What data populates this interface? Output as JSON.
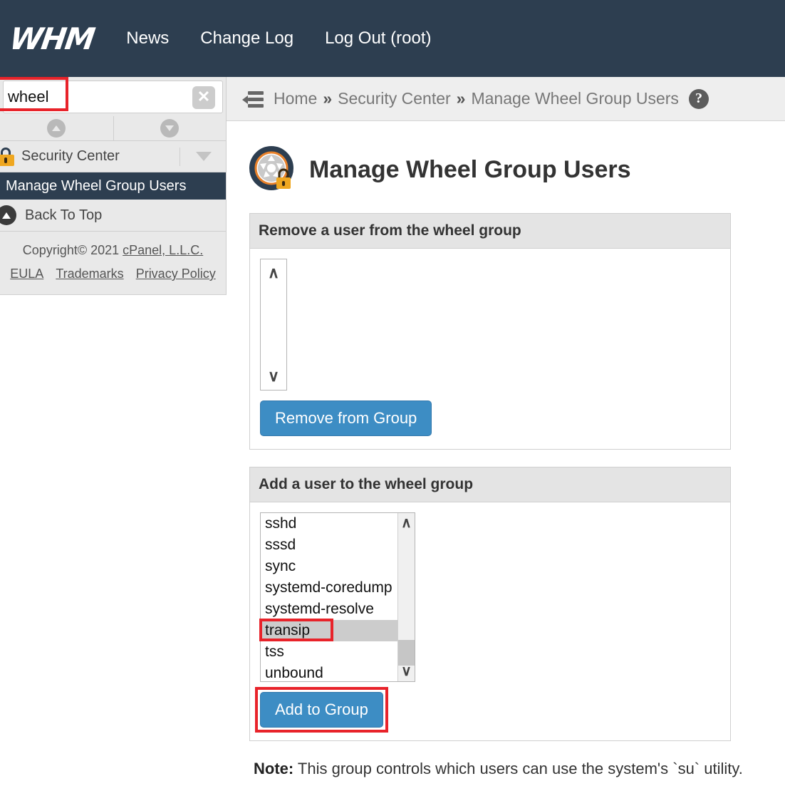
{
  "header": {
    "logo_text": "WHM",
    "nav": [
      {
        "label": "News"
      },
      {
        "label": "Change Log"
      },
      {
        "label": "Log Out (root)"
      }
    ]
  },
  "sidebar": {
    "search": {
      "value": "wheel",
      "placeholder": ""
    },
    "scroll_up_label": "scroll-up",
    "scroll_down_label": "scroll-down",
    "group": {
      "label": "Security Center"
    },
    "active_item": {
      "label": "Manage Wheel Group Users"
    },
    "back_to_top": {
      "label": "Back To Top"
    },
    "footer": {
      "copyright_prefix": "Copyright© 2021 ",
      "company_link": "cPanel, L.L.C.",
      "links": [
        {
          "label": "EULA"
        },
        {
          "label": "Trademarks"
        },
        {
          "label": "Privacy Policy"
        }
      ]
    }
  },
  "breadcrumb": {
    "items": [
      {
        "label": "Home"
      },
      {
        "label": "Security Center"
      },
      {
        "label": "Manage Wheel Group Users"
      }
    ],
    "separator": "»",
    "help_glyph": "?"
  },
  "page": {
    "title": "Manage Wheel Group Users",
    "icon": "wheel-lock-icon"
  },
  "remove_panel": {
    "heading": "Remove a user from the wheel group",
    "users": [],
    "button_label": "Remove from Group",
    "scroll_up_glyph": "∧",
    "scroll_down_glyph": "∨"
  },
  "add_panel": {
    "heading": "Add a user to the wheel group",
    "users": [
      {
        "label": "sshd",
        "selected": false
      },
      {
        "label": "sssd",
        "selected": false
      },
      {
        "label": "sync",
        "selected": false
      },
      {
        "label": "systemd-coredump",
        "selected": false
      },
      {
        "label": "systemd-resolve",
        "selected": false
      },
      {
        "label": "transip",
        "selected": true
      },
      {
        "label": "tss",
        "selected": false
      },
      {
        "label": "unbound",
        "selected": false
      }
    ],
    "selected_user": "transip",
    "button_label": "Add to Group",
    "scroll_up_glyph": "∧",
    "scroll_down_glyph": "∨"
  },
  "note": {
    "label": "Note:",
    "text": " This group controls which users can use the system's `su` utility."
  },
  "colors": {
    "header_bg": "#2d3e50",
    "accent_blue": "#3d8dc4",
    "annotation_red": "#e8232a",
    "lock_orange": "#efa720",
    "sidebar_bg": "#e9e9e9"
  }
}
